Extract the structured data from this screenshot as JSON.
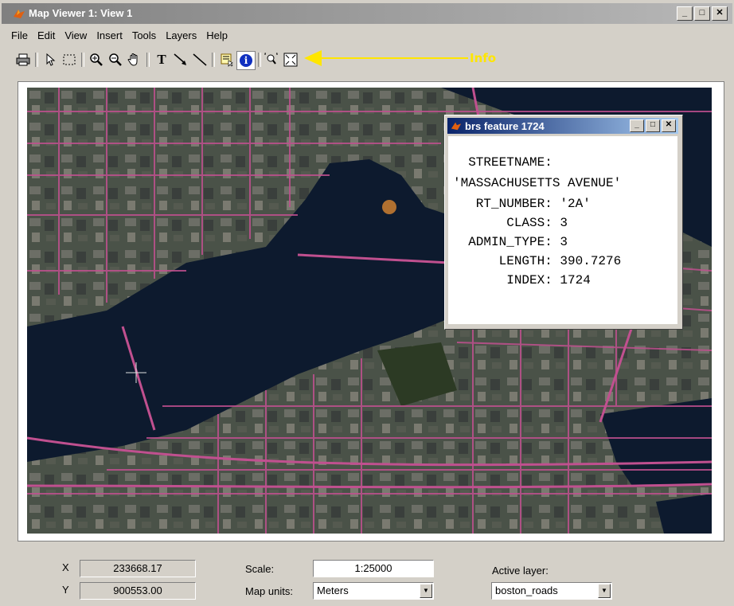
{
  "window": {
    "title": "Map Viewer 1: View 1"
  },
  "menu": [
    "File",
    "Edit",
    "View",
    "Insert",
    "Tools",
    "Layers",
    "Help"
  ],
  "toolbar": {
    "tools": [
      "print-icon",
      "select-arrow-icon",
      "select-area-icon",
      "zoom-in-icon",
      "zoom-out-icon",
      "pan-hand-icon",
      "text-icon",
      "arrow-annotation-icon",
      "line-annotation-icon",
      "datatip-icon",
      "info-icon",
      "zoom-fit-icon",
      "fit-to-window-icon"
    ],
    "annotation": "Info"
  },
  "popup": {
    "title": "brs feature 1724",
    "lines": [
      "  STREETNAME:",
      "'MASSACHUSETTS AVENUE'",
      "   RT_NUMBER: '2A'",
      "       CLASS: 3",
      "  ADMIN_TYPE: 3",
      "      LENGTH: 390.7276",
      "       INDEX: 1724"
    ]
  },
  "status": {
    "x_label": "X",
    "x_value": "233668.17",
    "y_label": "Y",
    "y_value": "900553.00",
    "scale_label": "Scale:",
    "scale_value": "1:25000",
    "units_label": "Map units:",
    "units_value": "Meters",
    "layer_label": "Active layer:",
    "layer_value": "boston_roads"
  },
  "colors": {
    "water": "#0d1a2e",
    "roads": "#c0508f",
    "land": "#4a5248"
  }
}
